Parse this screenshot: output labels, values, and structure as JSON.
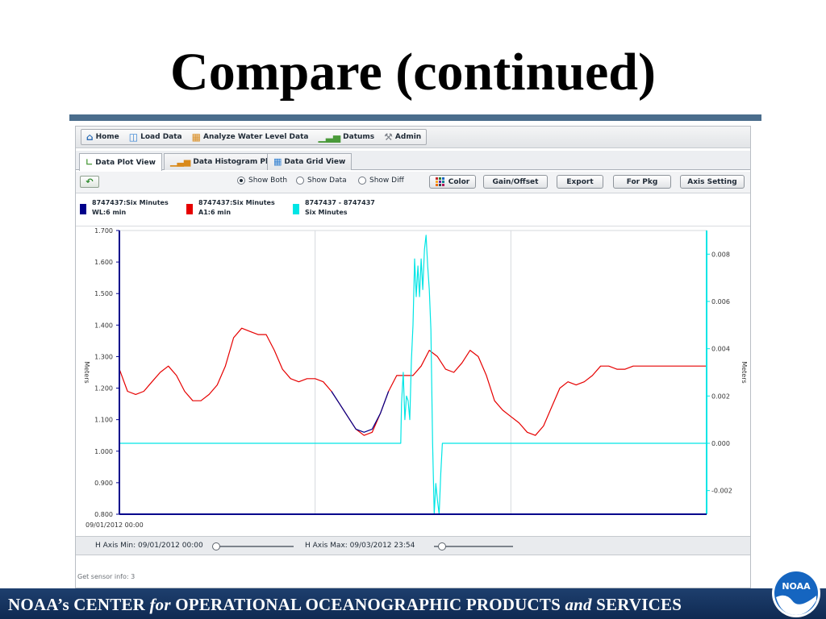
{
  "slide": {
    "title": "Compare (continued)",
    "footer": {
      "part1": "NOAA’s  CENTER ",
      "for": "for",
      "part2": "  OPERATIONAL  OCEANOGRAPHIC  PRODUCTS ",
      "and": "and",
      "part3": "  SERVICES"
    },
    "logo_text": "NOAA",
    "colors": {
      "rule": "#4a6d8c",
      "footer_bg": "#1e3f6e",
      "logo_blue": "#1565c0"
    }
  },
  "menubar": {
    "items": [
      {
        "label": "Home",
        "icon": "home-icon"
      },
      {
        "label": "Load Data",
        "icon": "load-data-icon"
      },
      {
        "label": "Analyze Water Level Data",
        "icon": "analyze-icon"
      },
      {
        "label": "Datums",
        "icon": "datums-icon"
      },
      {
        "label": "Admin",
        "icon": "admin-icon"
      }
    ]
  },
  "tabs": [
    {
      "label": "Data Plot View",
      "icon": "line-chart-icon",
      "active": true
    },
    {
      "label": "Data Histogram Plot",
      "icon": "histogram-icon",
      "active": false
    },
    {
      "label": "Data Grid View",
      "icon": "grid-icon",
      "active": false
    }
  ],
  "toolbar": {
    "back_icon": "back-arrow-icon",
    "radios": [
      {
        "label": "Show Both",
        "selected": true
      },
      {
        "label": "Show Data",
        "selected": false
      },
      {
        "label": "Show Diff",
        "selected": false
      }
    ],
    "buttons": {
      "color": "Color",
      "gain_offset": "Gain/Offset",
      "export": "Export",
      "for_pkg": "For Pkg",
      "axis_setting": "Axis Setting"
    }
  },
  "legend": [
    {
      "line1": "8747437:Six Minutes",
      "line2": "WL:6 min",
      "color": "#00008b"
    },
    {
      "line1": "8747437:Six Minutes",
      "line2": "A1:6 min",
      "color": "#e60000"
    },
    {
      "line1": "8747437 - 8747437",
      "line2": "Six Minutes",
      "color": "#00e5e5"
    }
  ],
  "chart_data": {
    "type": "line",
    "left_axis": {
      "label": "Meters",
      "ylim": [
        0.8,
        1.7
      ],
      "ticks": [
        "1.700",
        "1.600",
        "1.500",
        "1.400",
        "1.300",
        "1.200",
        "1.100",
        "1.000",
        "0.900",
        "0.800"
      ]
    },
    "right_axis": {
      "label": "Meters",
      "ylim": [
        -0.003,
        0.009
      ],
      "ticks": [
        "0.008",
        "0.006",
        "0.004",
        "0.002",
        "0.000",
        "-0.002"
      ]
    },
    "x_start_label": "09/01/2012 00:00",
    "x_range_hours": [
      0,
      72
    ],
    "grid": true,
    "series": [
      {
        "axis": "left",
        "color": "#e60000",
        "x": [
          0,
          1,
          2,
          3,
          4,
          5,
          6,
          7,
          8,
          9,
          10,
          11,
          12,
          13,
          14,
          15,
          16,
          17,
          18,
          19,
          20,
          21,
          22,
          23,
          24,
          25,
          26,
          27,
          28,
          29,
          30,
          31,
          32,
          33,
          34,
          35,
          36,
          37,
          38,
          39,
          40,
          41,
          42,
          43,
          44,
          45,
          46,
          47,
          48,
          49,
          50,
          51,
          52,
          53,
          54,
          55,
          56,
          57,
          58,
          59,
          60,
          61,
          62,
          63,
          64,
          65,
          66,
          67,
          68,
          69,
          70,
          71,
          72
        ],
        "y": [
          1.26,
          1.19,
          1.18,
          1.19,
          1.22,
          1.25,
          1.27,
          1.24,
          1.19,
          1.16,
          1.16,
          1.18,
          1.21,
          1.27,
          1.36,
          1.39,
          1.38,
          1.37,
          1.37,
          1.32,
          1.26,
          1.23,
          1.22,
          1.23,
          1.23,
          1.22,
          1.19,
          1.15,
          1.11,
          1.07,
          1.05,
          1.06,
          1.12,
          1.19,
          1.24,
          1.24,
          1.24,
          1.27,
          1.32,
          1.3,
          1.26,
          1.25,
          1.28,
          1.32,
          1.3,
          1.24,
          1.16,
          1.13,
          1.11,
          1.09,
          1.06,
          1.05,
          1.08,
          1.14,
          1.2,
          1.22,
          1.21,
          1.22,
          1.24,
          1.27,
          1.27,
          1.26,
          1.26,
          1.27,
          1.27,
          1.27,
          1.27,
          1.27,
          1.27,
          1.27,
          1.27,
          1.27,
          1.27
        ]
      },
      {
        "axis": "left",
        "color": "#00008b",
        "x": [
          26,
          27,
          28,
          29,
          30,
          31,
          32,
          33
        ],
        "y": [
          1.19,
          1.15,
          1.11,
          1.07,
          1.06,
          1.07,
          1.12,
          1.19
        ]
      },
      {
        "axis": "right",
        "color": "#00e5e5",
        "x": [
          0,
          34.5,
          34.6,
          34.8,
          35.0,
          35.2,
          35.4,
          35.6,
          35.8,
          36.0,
          36.2,
          36.4,
          36.6,
          36.8,
          37.0,
          37.2,
          37.4,
          37.6,
          37.8,
          38.0,
          38.2,
          38.4,
          38.6,
          38.8,
          39.0,
          39.2,
          39.4,
          39.6,
          39.8,
          40.0,
          40.2,
          40.4,
          40.6,
          40.8,
          72
        ],
        "y": [
          0.0,
          0.0,
          0.0017,
          0.003,
          0.001,
          0.002,
          0.0018,
          0.001,
          0.0035,
          0.005,
          0.0078,
          0.0062,
          0.0075,
          0.0062,
          0.0078,
          0.0065,
          0.0082,
          0.0088,
          0.0075,
          0.0065,
          0.0048,
          0.0,
          -0.003,
          -0.0017,
          -0.0024,
          -0.003,
          -0.0013,
          0.0,
          0.0,
          0.0,
          0.0,
          0.0,
          0.0,
          0.0,
          0.0
        ]
      }
    ]
  },
  "hscroll": {
    "min_label": "H Axis Min: 09/01/2012 00:00",
    "max_label": "H Axis Max: 09/03/2012 23:54",
    "min_position": 0.0,
    "max_position": 0.1
  },
  "status": {
    "text": "Get sensor info:  3"
  }
}
